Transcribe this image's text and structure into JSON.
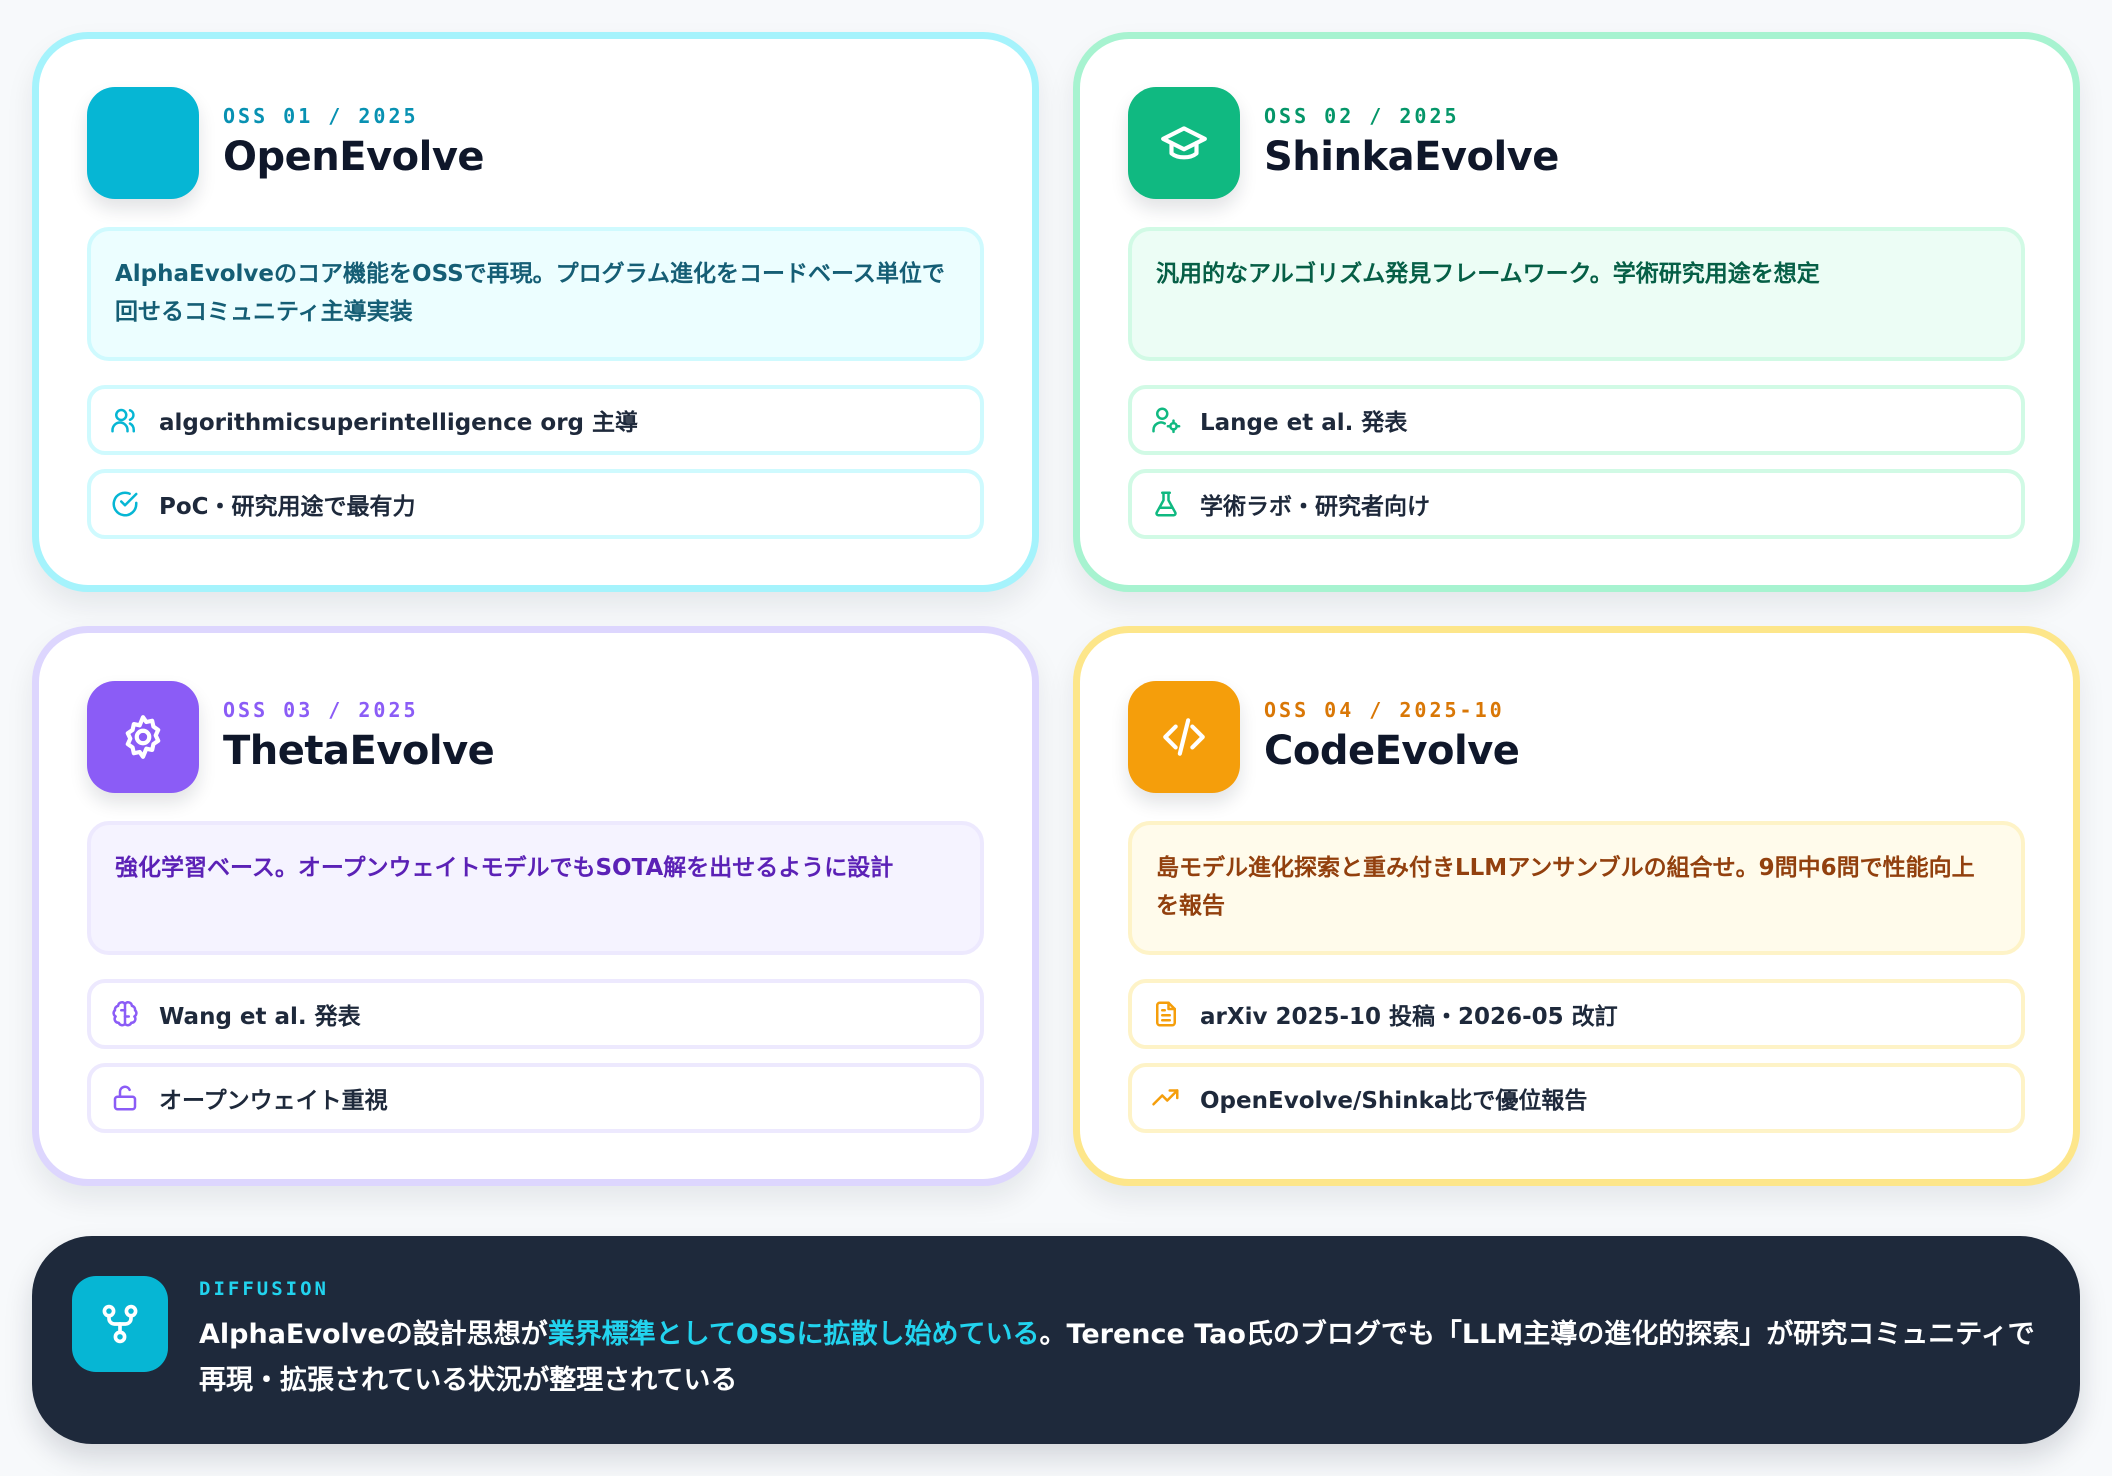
{
  "cards": [
    {
      "tag": "OSS 01 / 2025",
      "title": "OpenEvolve",
      "icon": "blank-badge",
      "accent": "#06b6d4",
      "description": "AlphaEvolveのコア機能をOSSで再現。プログラム進化をコードベース単位で回せるコミュニティ主導実装",
      "rows": [
        {
          "icon": "users-icon",
          "text": "algorithmicsuperintelligence org 主導"
        },
        {
          "icon": "check-circle-icon",
          "text": "PoC・研究用途で最有力"
        }
      ]
    },
    {
      "tag": "OSS 02 / 2025",
      "title": "ShinkaEvolve",
      "icon": "graduation-cap-icon",
      "accent": "#10b981",
      "description": "汎用的なアルゴリズム発見フレームワーク。学術研究用途を想定",
      "rows": [
        {
          "icon": "user-cog-icon",
          "text": "Lange et al. 発表"
        },
        {
          "icon": "flask-icon",
          "text": "学術ラボ・研究者向け"
        }
      ]
    },
    {
      "tag": "OSS 03 / 2025",
      "title": "ThetaEvolve",
      "icon": "gear-icon",
      "accent": "#8b5cf6",
      "description": "強化学習ベース。オープンウェイトモデルでもSOTA解を出せるように設計",
      "rows": [
        {
          "icon": "brain-icon",
          "text": "Wang et al. 発表"
        },
        {
          "icon": "unlock-icon",
          "text": "オープンウェイト重視"
        }
      ]
    },
    {
      "tag": "OSS 04 / 2025-10",
      "title": "CodeEvolve",
      "icon": "code-icon",
      "accent": "#f59e0b",
      "description": "島モデル進化探索と重み付きLLMアンサンブルの組合せ。9問中6問で性能向上を報告",
      "rows": [
        {
          "icon": "document-icon",
          "text": "arXiv 2025-10 投稿・2026-05 改訂"
        },
        {
          "icon": "trending-up-icon",
          "text": "OpenEvolve/Shinka比で優位報告"
        }
      ]
    }
  ],
  "banner": {
    "icon": "git-fork-icon",
    "label": "DIFFUSION",
    "text_before": "AlphaEvolveの設計思想が",
    "text_highlight": "業界標準としてOSSに拡散し始めている",
    "text_after": "。Terence Tao氏のブログでも「LLM主導の進化的探索」が研究コミュニティで再現・拡張されている状況が整理されている"
  }
}
